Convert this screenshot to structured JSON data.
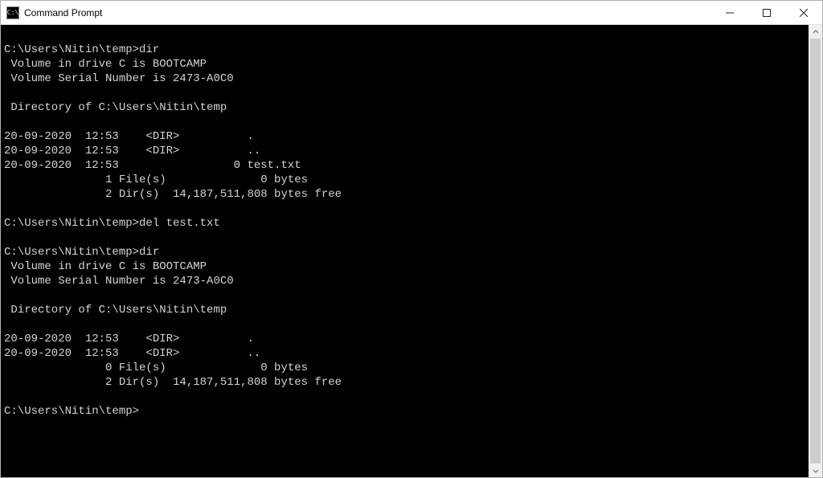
{
  "window": {
    "title": "Command Prompt",
    "icon_glyph": "C:\\"
  },
  "terminal_lines": [
    "",
    "C:\\Users\\Nitin\\temp>dir",
    " Volume in drive C is BOOTCAMP",
    " Volume Serial Number is 2473-A0C0",
    "",
    " Directory of C:\\Users\\Nitin\\temp",
    "",
    "20-09-2020  12:53    <DIR>          .",
    "20-09-2020  12:53    <DIR>          ..",
    "20-09-2020  12:53                 0 test.txt",
    "               1 File(s)              0 bytes",
    "               2 Dir(s)  14,187,511,808 bytes free",
    "",
    "C:\\Users\\Nitin\\temp>del test.txt",
    "",
    "C:\\Users\\Nitin\\temp>dir",
    " Volume in drive C is BOOTCAMP",
    " Volume Serial Number is 2473-A0C0",
    "",
    " Directory of C:\\Users\\Nitin\\temp",
    "",
    "20-09-2020  12:53    <DIR>          .",
    "20-09-2020  12:53    <DIR>          ..",
    "               0 File(s)              0 bytes",
    "               2 Dir(s)  14,187,511,808 bytes free",
    "",
    "C:\\Users\\Nitin\\temp>"
  ]
}
